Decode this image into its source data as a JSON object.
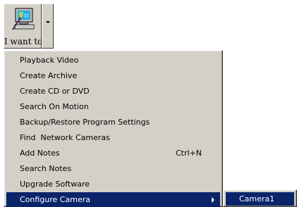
{
  "toolbar": {
    "button_label": "I want to",
    "icon": "computer-wand-icon"
  },
  "menu": {
    "items": [
      {
        "label": "Playback Video",
        "shortcut": ""
      },
      {
        "label": "Create Archive",
        "shortcut": ""
      },
      {
        "label": "Create CD or DVD",
        "shortcut": ""
      },
      {
        "label": "Search On Motion",
        "shortcut": ""
      },
      {
        "label": "Backup/Restore Program Settings",
        "shortcut": ""
      },
      {
        "label": "Find  Network Cameras",
        "shortcut": ""
      },
      {
        "label": "Add Notes",
        "shortcut": "Ctrl+N"
      },
      {
        "label": "Search Notes",
        "shortcut": ""
      },
      {
        "label": "Upgrade Software",
        "shortcut": ""
      },
      {
        "label": "Configure Camera",
        "shortcut": ""
      }
    ],
    "selected_index": 9
  },
  "submenu": {
    "items": [
      {
        "label": "Camera1"
      }
    ],
    "selected_index": 0
  },
  "colors": {
    "face": "#d4d0c8",
    "highlight": "#0a246a",
    "highlight_text": "#ffffff"
  }
}
